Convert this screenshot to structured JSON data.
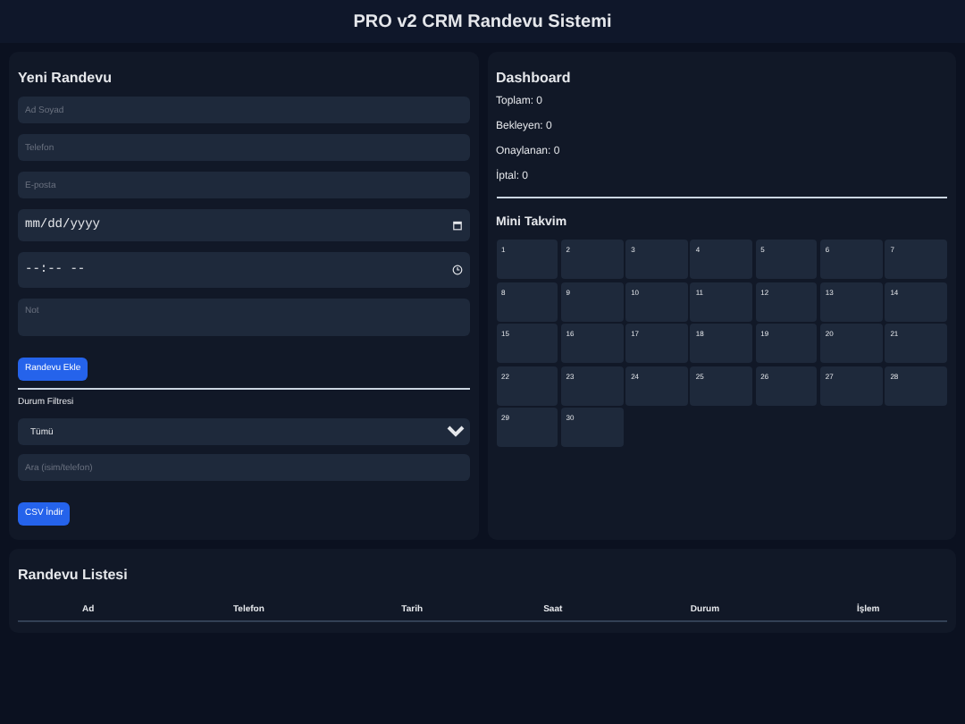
{
  "header": {
    "title": "PRO v2 CRM Randevu Sistemi"
  },
  "form": {
    "title": "Yeni Randevu",
    "fields": [
      {
        "kind": "text",
        "placeholder": "Ad Soyad"
      },
      {
        "kind": "text",
        "placeholder": "Telefon"
      },
      {
        "kind": "text",
        "placeholder": "E-posta"
      },
      {
        "kind": "date",
        "placeholder": "mm/dd/yyyy"
      },
      {
        "kind": "time",
        "placeholder": "--:-- --"
      },
      {
        "kind": "textarea",
        "placeholder": "Not"
      }
    ],
    "submit": "Randevu Ekle",
    "filter_label": "Durum Filtresi",
    "filter_value": "Tümü",
    "search_placeholder": "Ara (isim/telefon)",
    "csv": "CSV İndir"
  },
  "dashboard": {
    "title": "Dashboard",
    "stats": [
      "Toplam: 0",
      "Bekleyen: 0",
      "Onaylanan: 0",
      "İptal: 0"
    ],
    "calendar_title": "Mini Takvim",
    "days": [
      "1",
      "2",
      "3",
      "4",
      "5",
      "6",
      "7",
      "8",
      "9",
      "10",
      "11",
      "12",
      "13",
      "14",
      "15",
      "16",
      "17",
      "18",
      "19",
      "20",
      "21",
      "22",
      "23",
      "24",
      "25",
      "26",
      "27",
      "28",
      "29",
      "30"
    ]
  },
  "list": {
    "title": "Randevu Listesi",
    "columns": [
      "Ad",
      "Telefon",
      "Tarih",
      "Saat",
      "Durum",
      "İşlem"
    ]
  }
}
